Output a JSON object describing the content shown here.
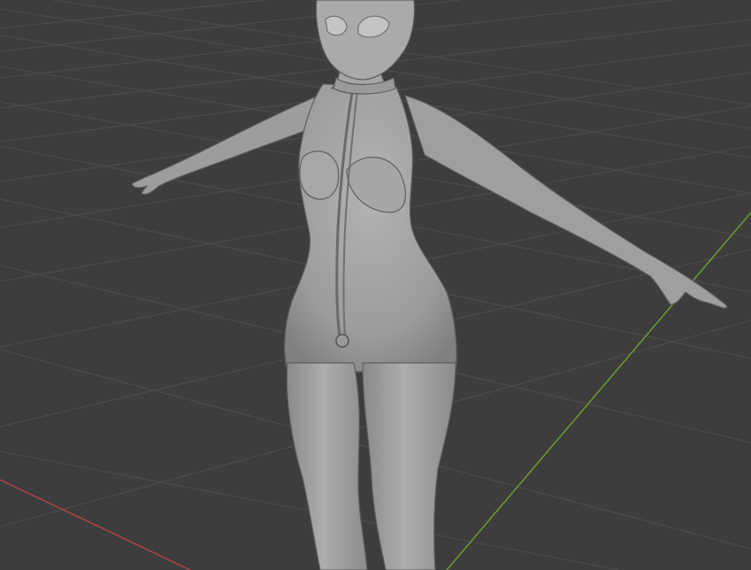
{
  "viewport": {
    "background_color": "#3d3d3d",
    "grid_color": "#4a4a4a",
    "x_axis_color": "#b0434a",
    "y_axis_color": "#6f9a2c"
  },
  "model": {
    "body_color": "#a4a4a4",
    "shading_color": "#7d7d7d",
    "outline_color": "#5e5e5e"
  }
}
